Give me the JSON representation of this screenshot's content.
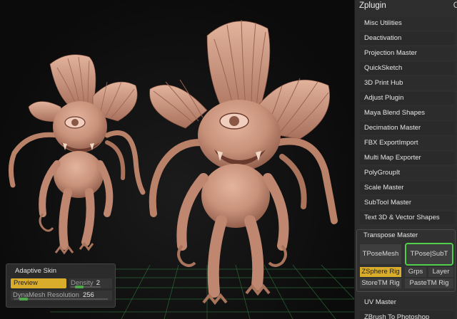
{
  "zplugin": {
    "title": "Zplugin",
    "corner_label": "C",
    "items": [
      {
        "label": "Misc Utilities"
      },
      {
        "label": "Deactivation"
      },
      {
        "label": "Projection Master"
      },
      {
        "label": "QuickSketch"
      },
      {
        "label": "3D Print Hub"
      },
      {
        "label": "Adjust Plugin"
      },
      {
        "label": "Maya Blend Shapes"
      },
      {
        "label": "Decimation Master"
      },
      {
        "label": "FBX ExportImport"
      },
      {
        "label": "Multi Map Exporter"
      },
      {
        "label": "PolyGroupIt"
      },
      {
        "label": "Scale Master"
      },
      {
        "label": "SubTool Master"
      },
      {
        "label": "Text 3D & Vector Shapes"
      }
    ],
    "transpose_master": {
      "title": "Transpose Master",
      "tposemesh": "TPoseMesh",
      "tpose_subt": "TPose|SubT",
      "zsphere_rig": "ZSphere Rig",
      "grps": "Grps",
      "layer": "Layer",
      "store_tm_rig": "StoreTM Rig",
      "paste_tm_rig": "PasteTM Rig"
    },
    "after_items": [
      {
        "label": "UV Master"
      },
      {
        "label": "ZBrush To Photoshop"
      }
    ]
  },
  "adaptive_skin": {
    "title": "Adaptive Skin",
    "preview": "Preview",
    "density_label": "Density",
    "density_value": "2",
    "dynamesh_label": "DynaMesh Resolution",
    "dynamesh_value": "256"
  },
  "colors": {
    "accent_yellow": "#d9ad2c",
    "highlight_green": "#4fcf4a",
    "model_clay": "#c8917a",
    "grid_green": "#2f7a3c"
  }
}
